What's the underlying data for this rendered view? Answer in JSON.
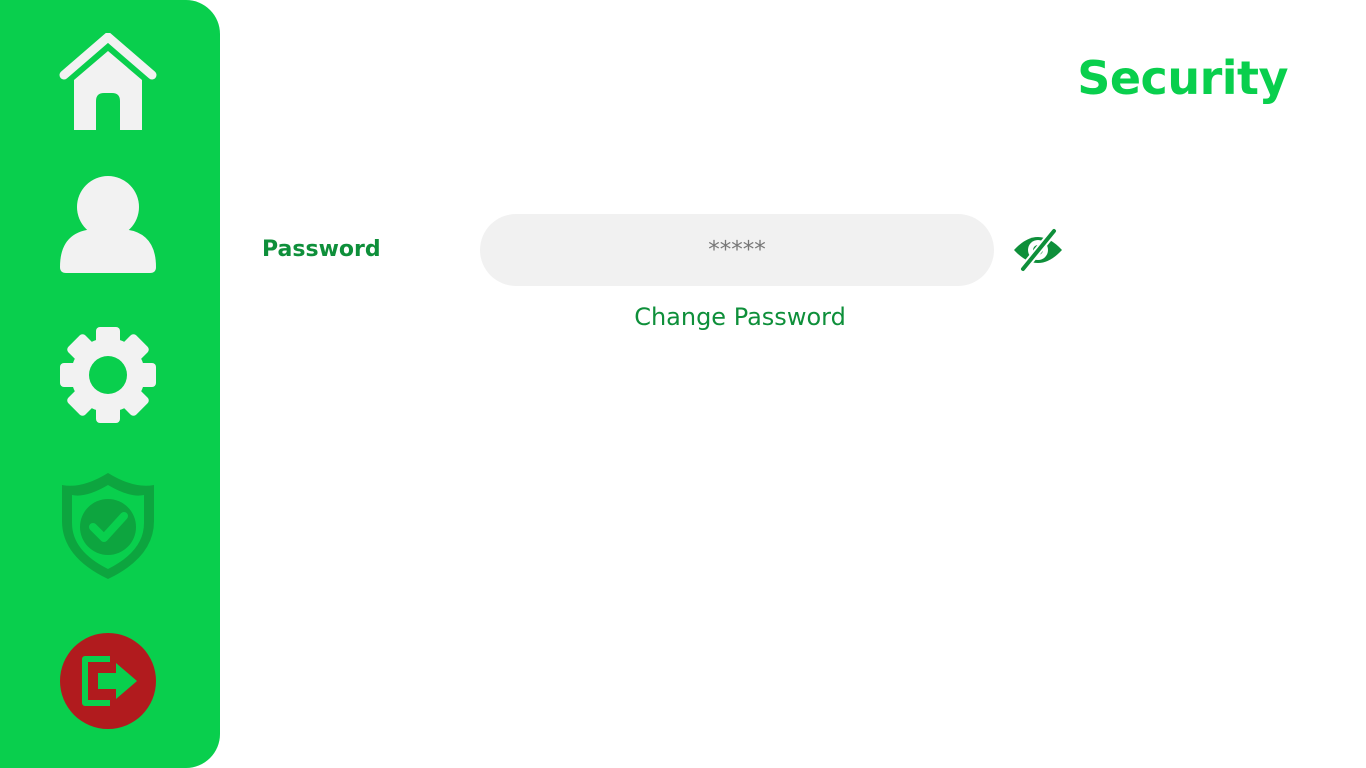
{
  "colors": {
    "sidebar_bg": "#09cf4d",
    "accent": "#09cf4d",
    "label_text": "#0e8f3a",
    "icon_light": "#f2f2f2",
    "shield_fill": "#0da53f",
    "logout_bg": "#b11b1e",
    "input_bg": "#f1f1f1"
  },
  "sidebar": {
    "items": [
      {
        "id": "home",
        "icon": "home-icon"
      },
      {
        "id": "profile",
        "icon": "user-icon"
      },
      {
        "id": "settings",
        "icon": "gear-icon"
      },
      {
        "id": "security",
        "icon": "shield-check-icon",
        "active": true
      },
      {
        "id": "logout",
        "icon": "logout-icon"
      }
    ]
  },
  "header": {
    "title": "Security"
  },
  "password": {
    "label": "Password",
    "value": "*****",
    "visibility_icon": "eye-slash-icon",
    "change_link": "Change Password"
  }
}
